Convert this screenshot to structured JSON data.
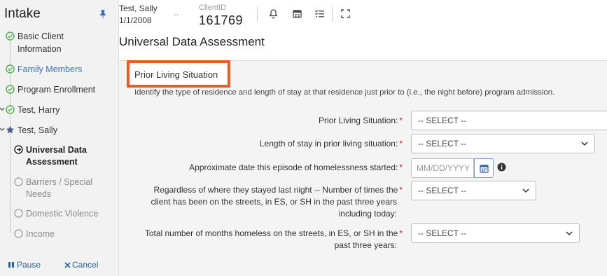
{
  "sidebar": {
    "title": "Intake",
    "steps": [
      {
        "line1": "Basic Client",
        "line2": "Information",
        "state": "complete"
      },
      {
        "line1": "Family Members",
        "state": "complete-link"
      },
      {
        "line1": "Program Enrollment",
        "state": "complete"
      },
      {
        "line1": "Test, Harry",
        "state": "complete-member"
      },
      {
        "line1": "Test, Sally",
        "state": "head"
      },
      {
        "line1": "Universal Data",
        "line2": "Assessment",
        "state": "current"
      },
      {
        "line1": "Barriers / Special",
        "line2": "Needs",
        "state": "pending"
      },
      {
        "line1": "Domestic Violence",
        "state": "pending"
      },
      {
        "line1": "Income",
        "state": "pending"
      }
    ],
    "pause_label": "Pause",
    "cancel_label": "Cancel"
  },
  "header": {
    "client_name": "Test, Sally",
    "client_dob": "1/1/2008",
    "separator": "--",
    "client_id_label": "ClientID",
    "client_id": "161769",
    "icons": [
      "bell-icon",
      "calendar-icon",
      "checklist-icon",
      "expand-icon"
    ]
  },
  "page_title": "Universal Data Assessment",
  "section": {
    "title": "Prior Living Situation",
    "instructions": "Identify the type of residence and length of stay at that residence just prior to (i.e., the night before) program admission."
  },
  "form": {
    "prior_living_label": "Prior Living Situation:",
    "prior_living_value": "-- SELECT --",
    "length_stay_label": "Length of stay in prior living situation:",
    "length_stay_value": "-- SELECT --",
    "date_label": "Approximate date this episode of homelessness started:",
    "date_placeholder": "MM/DD/YYYY",
    "times_label_1": "Regardless of where they stayed last night -- Number of times the",
    "times_label_2": "client has been on the streets, in ES, or SH in the past three years",
    "times_label_3": "including today:",
    "times_value": "-- SELECT --",
    "months_label_1": "Total number of months homeless on the streets, in ES, or SH in the",
    "months_label_2": "past three years:",
    "months_value": "-- SELECT --",
    "required_mark": "*"
  },
  "colors": {
    "accent_orange": "#f15a1e",
    "link_blue": "#2a5ea8",
    "complete_green": "#4caf50",
    "required_red": "#c62828"
  }
}
